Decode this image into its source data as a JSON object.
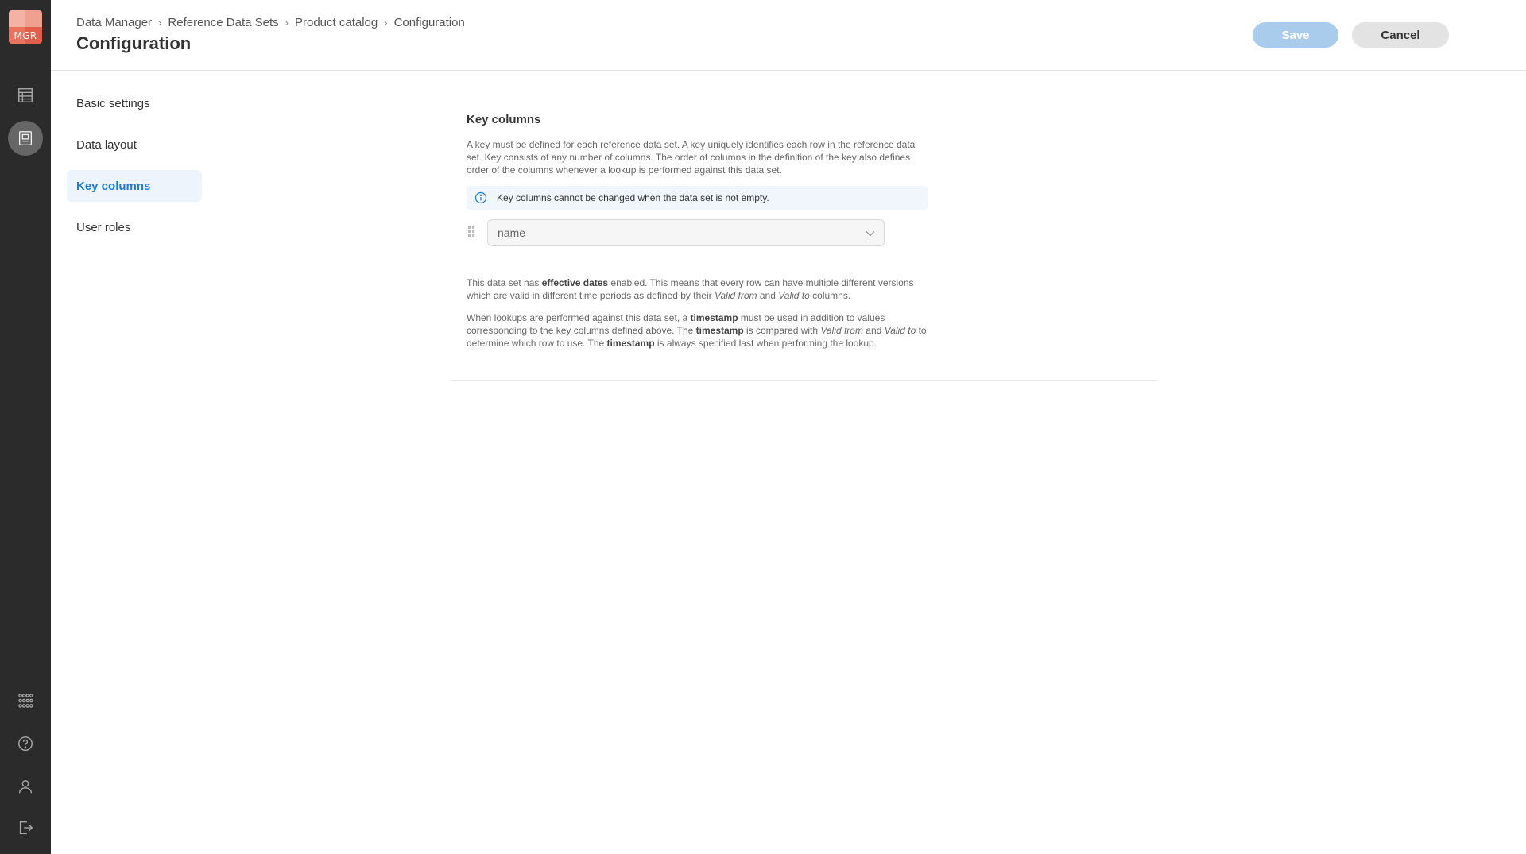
{
  "app": {
    "logo_text": "MGR"
  },
  "breadcrumb": [
    "Data Manager",
    "Reference Data Sets",
    "Product catalog",
    "Configuration"
  ],
  "page_title": "Configuration",
  "actions": {
    "save": "Save",
    "cancel": "Cancel"
  },
  "rail": {
    "top_icons": [
      "table-grid-icon",
      "document-icon"
    ],
    "bottom_icons": [
      "apps-grid-icon",
      "help-icon",
      "user-icon",
      "logout-icon"
    ]
  },
  "sidenav": [
    {
      "label": "Basic settings",
      "active": false
    },
    {
      "label": "Data layout",
      "active": false
    },
    {
      "label": "Key columns",
      "active": true
    },
    {
      "label": "User roles",
      "active": false
    }
  ],
  "key_columns": {
    "title": "Key columns",
    "description": "A key must be defined for each reference data set. A key uniquely identifies each row in the reference data set. Key consists of any number of columns. The order of columns in the definition of the key also defines order of the columns whenever a lookup is performed against this data set.",
    "info": "Key columns cannot be changed when the data set is not empty.",
    "column_value": "name",
    "p1": {
      "t1": "This data set has ",
      "b1": "effective dates",
      "t2": " enabled. This means that every row can have multiple different versions which are valid in different time periods as defined by their ",
      "i1": "Valid from",
      "t3": " and ",
      "i2": "Valid to",
      "t4": " columns."
    },
    "p2": {
      "t1": "When lookups are performed against this data set, a ",
      "b1": "timestamp",
      "t2": " must be used in addition to values corresponding to the key columns defined above. The ",
      "b2": "timestamp",
      "t3": " is compared with ",
      "i1": "Valid from",
      "t4": " and ",
      "i2": "Valid to",
      "t5": " to determine which row to use. The ",
      "b3": "timestamp",
      "t6": " is always specified last when performing the lookup."
    }
  },
  "colors": {
    "rail": "#2b2b2b",
    "accent": "#1d7bd7",
    "save_disabled": "#a9ccec"
  }
}
